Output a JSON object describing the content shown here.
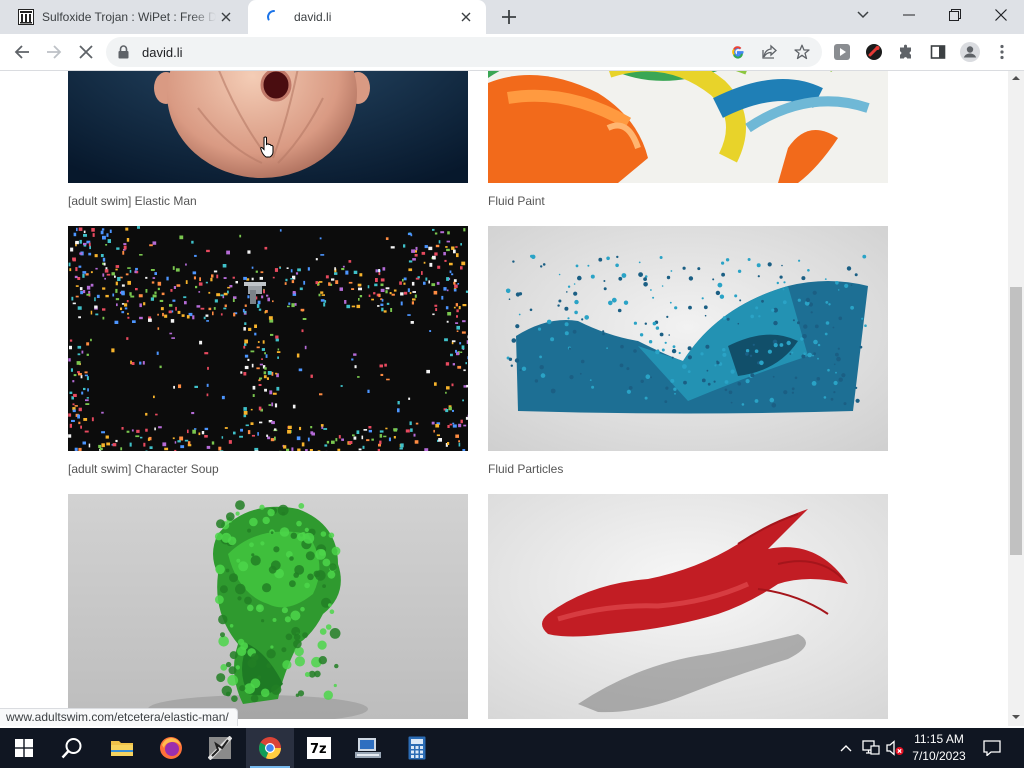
{
  "browser": {
    "tabs": [
      {
        "title": "Sulfoxide Trojan : WiPet : Free Do",
        "favicon": "archive-icon",
        "active": false
      },
      {
        "title": "david.li",
        "favicon": "loading-spinner-icon",
        "active": true
      }
    ],
    "address": "david.li",
    "status_url": "www.adultswim.com/etcetera/elastic-man/",
    "icons": [
      "back-icon",
      "forward-icon",
      "stop-icon",
      "lock-icon",
      "google-icon",
      "share-icon",
      "star-icon",
      "extension-icon",
      "sidepanel-icon",
      "profile-icon",
      "menu-icon"
    ]
  },
  "gallery": [
    {
      "caption": "[adult swim] Elastic Man",
      "art": "elastic-man"
    },
    {
      "caption": "Fluid Paint",
      "art": "fluid-paint"
    },
    {
      "caption": "[adult swim] Character Soup",
      "art": "character-soup"
    },
    {
      "caption": "Fluid Particles",
      "art": "fluid-particles"
    },
    {
      "caption": "",
      "art": "green-creature"
    },
    {
      "caption": "",
      "art": "red-fluid"
    }
  ],
  "taskbar": {
    "apps": [
      "start-icon",
      "search-icon",
      "file-explorer-icon",
      "firefox-icon",
      "app-icon",
      "chrome-icon",
      "7zip-icon",
      "network-app-icon",
      "calculator-icon"
    ],
    "active_app": "chrome-icon",
    "time": "11:15 AM",
    "date": "7/10/2023"
  },
  "colors": {
    "tabstrip": "#dee1e6",
    "taskbar": "#101622",
    "accent": "#1a73e8"
  }
}
